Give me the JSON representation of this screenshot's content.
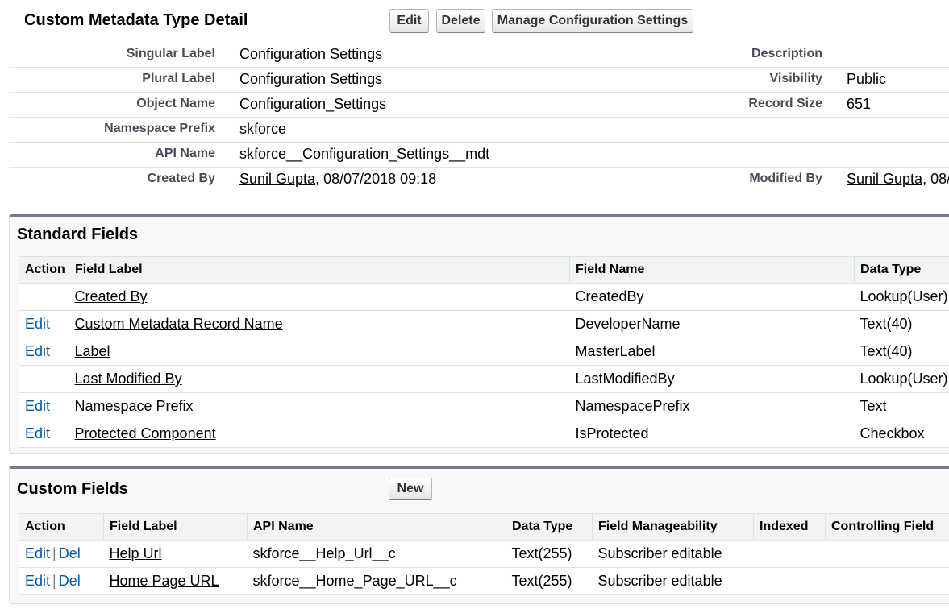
{
  "header": {
    "title": "Custom Metadata Type Detail",
    "buttons": {
      "edit": "Edit",
      "delete": "Delete",
      "manage": "Manage Configuration Settings"
    }
  },
  "detail": {
    "singular_label": {
      "label": "Singular Label",
      "value": "Configuration Settings"
    },
    "plural_label": {
      "label": "Plural Label",
      "value": "Configuration Settings"
    },
    "object_name": {
      "label": "Object Name",
      "value": "Configuration_Settings"
    },
    "namespace_prefix": {
      "label": "Namespace Prefix",
      "value": "skforce"
    },
    "api_name": {
      "label": "API Name",
      "value": "skforce__Configuration_Settings__mdt"
    },
    "created_by": {
      "label": "Created By",
      "user": "Sunil Gupta",
      "date": ", 08/07/2018 09:18"
    },
    "description": {
      "label": "Description",
      "value": ""
    },
    "visibility": {
      "label": "Visibility",
      "value": "Public"
    },
    "record_size": {
      "label": "Record Size",
      "value": "651"
    },
    "modified_by": {
      "label": "Modified By",
      "user": "Sunil Gupta",
      "date": ", 08/"
    }
  },
  "standard_fields": {
    "title": "Standard Fields",
    "columns": [
      "Action",
      "Field Label",
      "Field Name",
      "Data Type"
    ],
    "rows": [
      {
        "action": "",
        "label": "Created By",
        "name": "CreatedBy",
        "type": "Lookup(User)"
      },
      {
        "action": "Edit",
        "label": "Custom Metadata Record Name",
        "name": "DeveloperName",
        "type": "Text(40)"
      },
      {
        "action": "Edit",
        "label": "Label",
        "name": "MasterLabel",
        "type": "Text(40)"
      },
      {
        "action": "",
        "label": "Last Modified By",
        "name": "LastModifiedBy",
        "type": "Lookup(User)"
      },
      {
        "action": "Edit",
        "label": "Namespace Prefix",
        "name": "NamespacePrefix",
        "type": "Text"
      },
      {
        "action": "Edit",
        "label": "Protected Component",
        "name": "IsProtected",
        "type": "Checkbox"
      }
    ]
  },
  "custom_fields": {
    "title": "Custom Fields",
    "new_button": "New",
    "columns": [
      "Action",
      "Field Label",
      "API Name",
      "Data Type",
      "Field Manageability",
      "Indexed",
      "Controlling Field"
    ],
    "rows": [
      {
        "edit": "Edit",
        "sep": "|",
        "del": "Del",
        "label": "Help Url",
        "api": "skforce__Help_Url__c",
        "type": "Text(255)",
        "manage": "Subscriber editable",
        "indexed": "",
        "controlling": ""
      },
      {
        "edit": "Edit",
        "sep": "|",
        "del": "Del",
        "label": "Home Page URL",
        "api": "skforce__Home_Page_URL__c",
        "type": "Text(255)",
        "manage": "Subscriber editable",
        "indexed": "",
        "controlling": ""
      }
    ]
  }
}
